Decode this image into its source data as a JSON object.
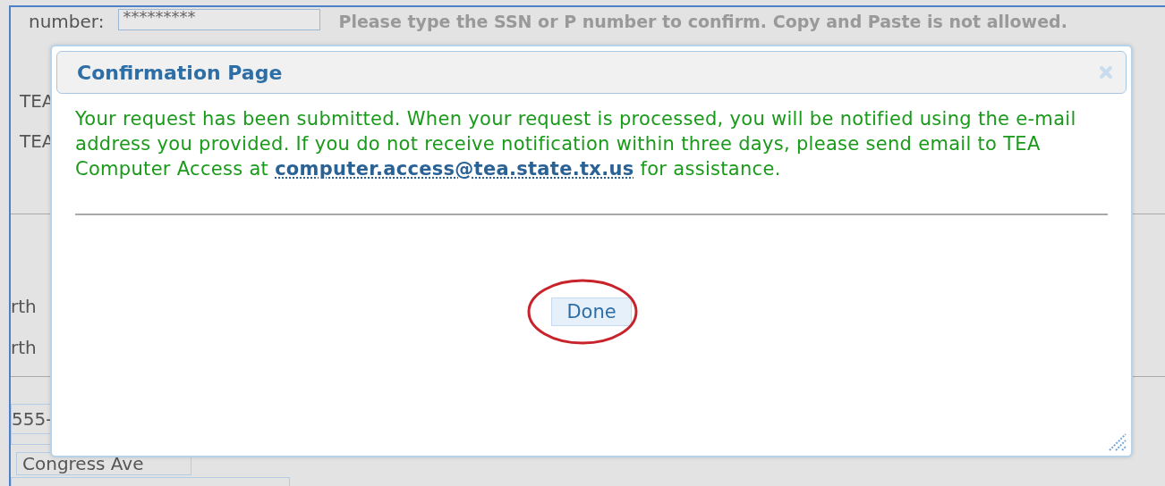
{
  "background_form": {
    "ssn_label": "number:",
    "ssn_field": {
      "value": "*********"
    },
    "ssn_hint": "Please type the SSN or P number to confirm. Copy and Paste is not allowed.",
    "upper_labels": [
      "TEA",
      "TEA"
    ],
    "lower_labels": [
      "rth",
      "rth"
    ],
    "phone_field": {
      "value": "555-"
    },
    "address_field": {
      "value": "Congress Ave"
    }
  },
  "dialog": {
    "title": "Confirmation Page",
    "message": {
      "before": "Your request has been submitted. When your request is processed, you will be notified using the e-mail address you provided. If you do not receive notification within three days, please send email to TEA Computer Access at ",
      "link": "computer.access@tea.state.tx.us",
      "after": " for assistance."
    },
    "buttons": [
      {
        "label": "Done",
        "highlighted": true
      }
    ]
  }
}
